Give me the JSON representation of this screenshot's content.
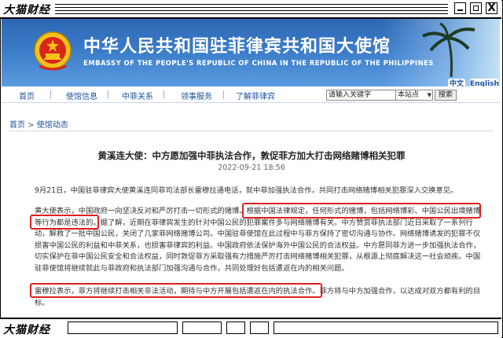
{
  "window": {
    "brand": "大猫财经",
    "close_glyph": "X"
  },
  "banner": {
    "title_cn": "中华人民共和国驻菲律宾共和国大使馆",
    "title_en": "EMBASSY OF THE PEOPLE'S REPUBLIC OF CHINA IN THE REPUBLIC OF THE PHILIPPINES",
    "lang_zh": "中文",
    "lang_en": "English"
  },
  "nav": {
    "items": [
      "首页",
      "使馆信息",
      "中菲关系",
      "领事服务",
      "了解菲律宾"
    ],
    "search_placeholder": "请输入关键字",
    "scope_selected": "本站点",
    "search_button": "搜索"
  },
  "breadcrumb": {
    "home": "首页",
    "separator": ">",
    "current": "使馆动态"
  },
  "article": {
    "headline": "黄溪连大使：中方愿加强中菲执法合作，敦促菲方加大打击网络赌博相关犯罪",
    "date": "2022-09-21 18:56",
    "p1": "9月21日，中国驻菲律宾大使黄溪连同菲司法部长雷穆拉通电话，就中菲加强执法合作，共同打击网络赌博相关犯罪深入交换意见。",
    "p2": "黄大使表示，中国政府一向坚决反对和严厉打击一切形式的赌博。根据中国法律规定，任何形式的赌博，包括网络博彩、中国公民出境赌博等行为都是违法的。据了解，近期在菲律宾发生的针对中国公民的犯罪案件多与网络赌博有关。中方赞赏菲执法部门近日采取了一系列行动，解救了一批中国公民，关闭了几家菲网络赌博公司。中国驻菲使馆在此过程中与菲方保持了密切沟通与协作。网络赌博诱发的犯罪不仅损害中国公民的利益和中菲关系，也损害菲律宾的利益。中国政府依法保护海外中国公民的合法权益。中方愿同菲方进一步加强执法合作，切实保护在菲中国公民安全和合法权益，同时敦促菲方采取强有力措施严厉打击网络赌博相关犯罪，从根源上彻底解决这一社会顽疾。中国驻菲使馆将继续就此与菲政府和执法部门加强沟通与合作，共同处理好包括遣返在内的相关问题。",
    "p3": "雷穆拉表示，菲方将继续打击相关非法活动，期待与中方开展包括遣返在内的执法合作。菲方将与中方加强合作，以达成对双方都有利的目标。"
  },
  "colors": {
    "banner_blue": "#2e67b4",
    "link_blue": "#1b4f9a",
    "highlight_red": "#e02020"
  },
  "icons": {
    "emblem": "national-emblem-icon",
    "minimize": "minimize-icon",
    "maximize": "maximize-icon",
    "close": "close-icon",
    "dropdown": "chevron-down-icon"
  }
}
